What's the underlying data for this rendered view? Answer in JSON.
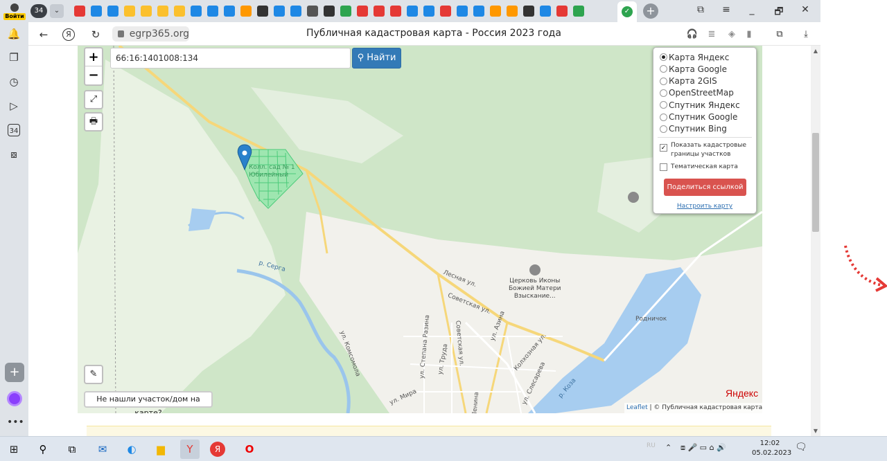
{
  "tabbar": {
    "login_label": "Войти",
    "tab_count": "34",
    "favicons": [
      "#e53935",
      "#1e88e5",
      "#1e88e5",
      "#fbc02d",
      "#fbc02d",
      "#fbc02d",
      "#fbc02d",
      "#1e88e5",
      "#1e88e5",
      "#1e88e5",
      "#ff9800",
      "#333333",
      "#1e88e5",
      "#1e88e5",
      "#555555",
      "#333333",
      "#2ea44f",
      "#e53935",
      "#e53935",
      "#e53935",
      "#1e88e5",
      "#1e88e5",
      "#e53935",
      "#1e88e5",
      "#1e88e5",
      "#ff9800",
      "#ff9800",
      "#333333",
      "#1e88e5",
      "#e53935",
      "#2ea44f"
    ],
    "new_tab": "+",
    "controls": [
      "⧉",
      "≡",
      "_",
      "🗗",
      "✕"
    ]
  },
  "toolbar": {
    "back": "←",
    "yandex": "Я",
    "reload": "↻",
    "url": "egrp365.org",
    "page_title": "Публичная кадастровая карта - Россия 2023 года"
  },
  "map": {
    "search_value": "66:16:1401008:134",
    "find_label": "Найти",
    "zoom_in": "+",
    "zoom_out": "−",
    "layers": [
      "Карта Яндекс",
      "Карта Google",
      "Карта 2GIS",
      "OpenStreetMap",
      "Спутник Яндекс",
      "Спутник Google",
      "Спутник Bing"
    ],
    "selected_layer": "Карта Яндекс",
    "show_cadastral": "Показать кадастровые границы участков",
    "show_cadastral_checked": true,
    "thematic": "Тематическая карта",
    "thematic_checked": false,
    "share_label": "Поделиться ссылкой",
    "configure_label": "Настроить карту",
    "not_found_label": "Не нашли участок/дом на карте?",
    "attribution_leaflet": "Leaflet",
    "attribution_rest": "| © Публичная кадастровая карта, ©",
    "yandex_logo": "Яндекс",
    "labels": {
      "garden": "Колл. сад № 1\nЮбилейный",
      "river": "р. Серга",
      "lesnaya": "Лесная ул.",
      "sovetskaya": "Советская ул.",
      "church": "Церковь Иконы\nБожией Матери\nВзыскание...",
      "rodnichok": "Родничок",
      "komsomola": "ул. Комсомола",
      "razina": "ул. Степана Разина",
      "truda": "ул. Труда",
      "sovetskaya2": "Советская ул.",
      "azina": "ул. Азина",
      "kolkhoznaya": "Колхозная ул.",
      "slesareva": "ул. Слесарева",
      "mira": "ул. Мира",
      "lenina": "Ленина",
      "koza": "р. Коза"
    }
  },
  "taskbar": {
    "lang": "RU",
    "time": "12:02",
    "date": "05.02.2023"
  }
}
